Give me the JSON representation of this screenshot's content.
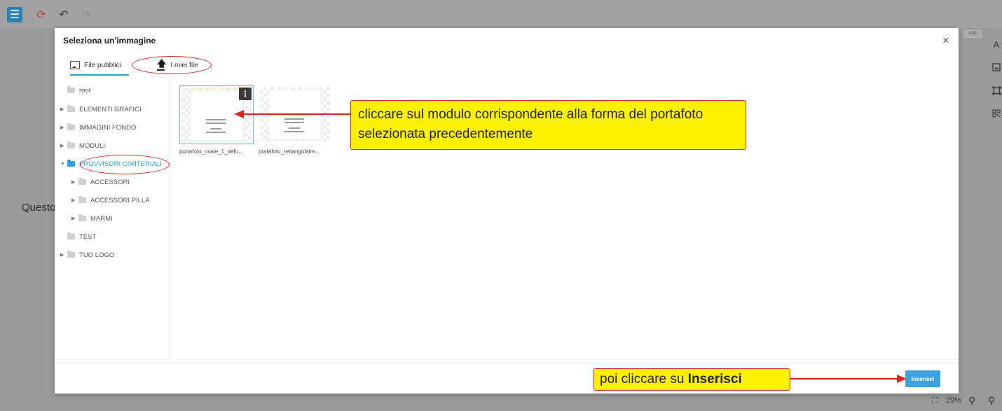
{
  "toolbar": {
    "layers_icon": "layers-icon",
    "history_icon": "history-icon",
    "undo_icon": "undo-icon",
    "redo_icon": "redo-icon"
  },
  "canvas": {
    "text": "Questo"
  },
  "right_toolbar": {
    "text_label": "A",
    "tag_label": "Add"
  },
  "bottom_bar": {
    "zoom": "29%"
  },
  "modal": {
    "title": "Seleziona un'immagine",
    "close_label": "×",
    "tabs": [
      {
        "label": "File pubblici",
        "icon": "image-icon",
        "active": true
      },
      {
        "label": "I miei file",
        "icon": "upload-icon",
        "active": false
      }
    ],
    "tree": [
      {
        "label": "root",
        "level": 0,
        "expandable": false
      },
      {
        "label": "ELEMENTI GRAFICI",
        "level": 0,
        "expandable": true
      },
      {
        "label": "IMMAGINI FONDO",
        "level": 0,
        "expandable": true
      },
      {
        "label": "MODULI",
        "level": 0,
        "expandable": true
      },
      {
        "label": "PROVVISORI CIMITERIALI",
        "level": 0,
        "expandable": true,
        "expanded": true,
        "active": true
      },
      {
        "label": "ACCESSORI",
        "level": 1,
        "expandable": true
      },
      {
        "label": "ACCESSORI PILLA",
        "level": 1,
        "expandable": true
      },
      {
        "label": "MARMI",
        "level": 1,
        "expandable": true
      },
      {
        "label": "TEST",
        "level": 0,
        "expandable": false
      },
      {
        "label": "TUO LOGO",
        "level": 0,
        "expandable": true
      }
    ],
    "files": [
      {
        "name": "portafoto_ovale_1_defu...",
        "selected": true
      },
      {
        "name": "portafoto_rettangolatre...",
        "selected": false
      }
    ],
    "insert_label": "Inserisci"
  },
  "callouts": {
    "select_module": "cliccare sul modulo corrispondente alla  forma del portafoto selezionata precedentemente",
    "click_insert_prefix": "poi cliccare su ",
    "click_insert_bold": "Inserisci"
  },
  "colors": {
    "accent": "#2e9fd8",
    "annotation_red": "#d62828",
    "annotation_yellow": "#fff200"
  }
}
